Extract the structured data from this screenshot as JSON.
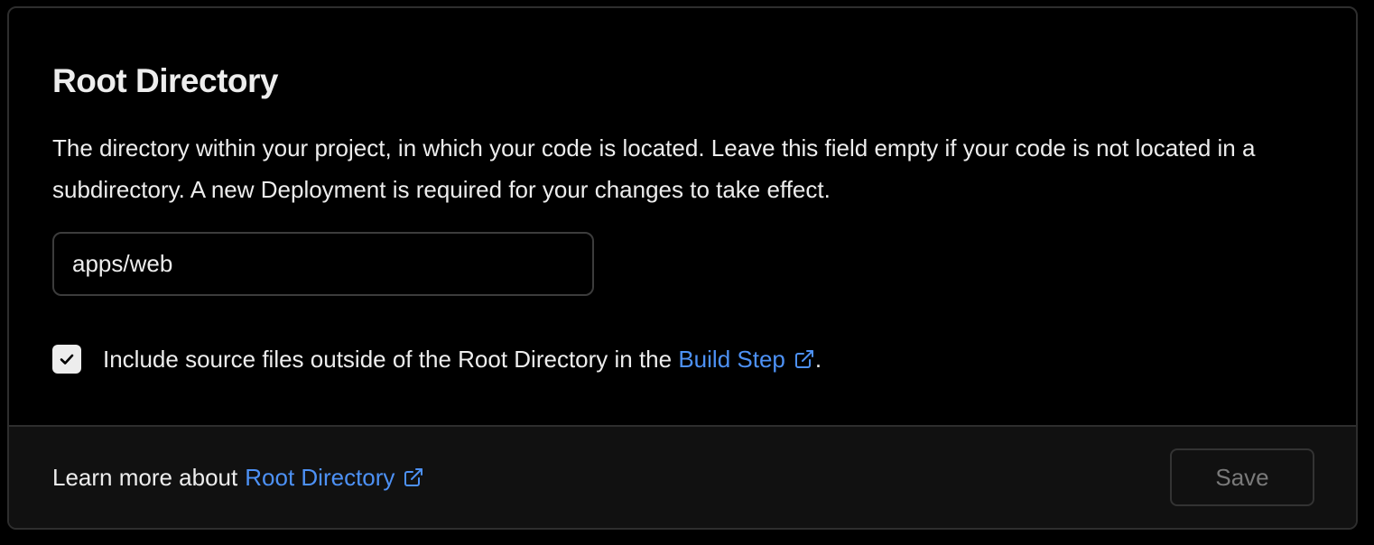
{
  "section": {
    "title": "Root Directory",
    "description": "The directory within your project, in which your code is located. Leave this field empty if your code is not located in a subdirectory. A new Deployment is required for your changes to take effect."
  },
  "root_input": {
    "value": "apps/web"
  },
  "include_checkbox": {
    "checked": true,
    "label_prefix": "Include source files outside of the Root Directory in the ",
    "link_text": "Build Step",
    "label_suffix": "."
  },
  "footer": {
    "prefix": "Learn more about",
    "link_text": "Root Directory",
    "save_label": "Save",
    "save_enabled": false
  },
  "colors": {
    "link": "#4d91f5",
    "background": "#000000",
    "footer_background": "#111111"
  },
  "icons": [
    "checkmark-icon",
    "external-link-icon"
  ]
}
